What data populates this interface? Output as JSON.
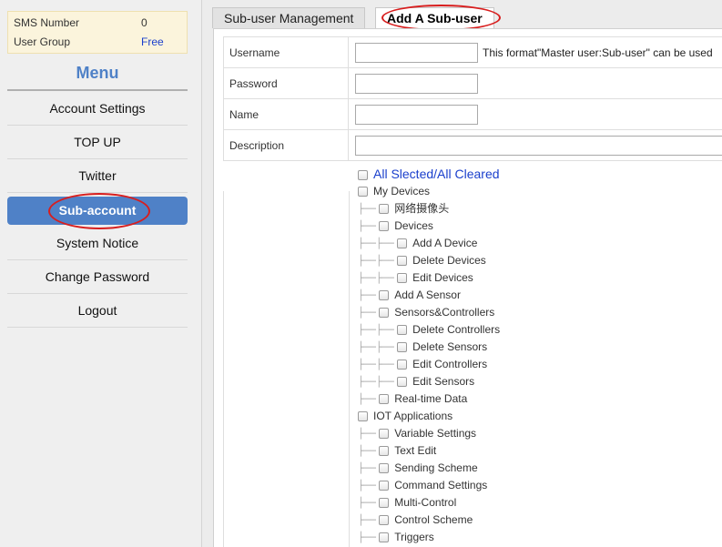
{
  "sidebar": {
    "info": [
      {
        "label": "SMS Number",
        "value": "0"
      },
      {
        "label": "User Group",
        "value": "Free"
      }
    ],
    "menu_title": "Menu",
    "items": [
      {
        "label": "Account Settings"
      },
      {
        "label": "TOP UP"
      },
      {
        "label": "Twitter"
      },
      {
        "label": "Sub-account"
      },
      {
        "label": "System Notice"
      },
      {
        "label": "Change Password"
      },
      {
        "label": "Logout"
      }
    ]
  },
  "tabs": [
    {
      "label": "Sub-user Management"
    },
    {
      "label": "Add A Sub-user"
    }
  ],
  "form": {
    "username_label": "Username",
    "username_value": "",
    "username_hint": "This format\"Master user:Sub-user\" can be used",
    "password_label": "Password",
    "password_value": "",
    "name_label": "Name",
    "name_value": "",
    "description_label": "Description",
    "description_value": ""
  },
  "permissions": [
    {
      "label": "All Slected/All Cleared"
    },
    {
      "label": "My Devices"
    },
    {
      "label": "网络摄像头"
    },
    {
      "label": "Devices"
    },
    {
      "label": "Add A Device"
    },
    {
      "label": "Delete Devices"
    },
    {
      "label": "Edit Devices"
    },
    {
      "label": "Add A Sensor"
    },
    {
      "label": "Sensors&Controllers"
    },
    {
      "label": "Delete Controllers"
    },
    {
      "label": "Delete Sensors"
    },
    {
      "label": "Edit Controllers"
    },
    {
      "label": "Edit Sensors"
    },
    {
      "label": "Real-time Data"
    },
    {
      "label": "IOT Applications"
    },
    {
      "label": "Variable Settings"
    },
    {
      "label": "Text Edit"
    },
    {
      "label": "Sending Scheme"
    },
    {
      "label": "Command Settings"
    },
    {
      "label": "Multi-Control"
    },
    {
      "label": "Control Scheme"
    },
    {
      "label": "Triggers"
    }
  ],
  "colors": {
    "accent": "#4f81c7",
    "highlight_oval": "#d81e1e",
    "link": "#1a3fcc"
  }
}
